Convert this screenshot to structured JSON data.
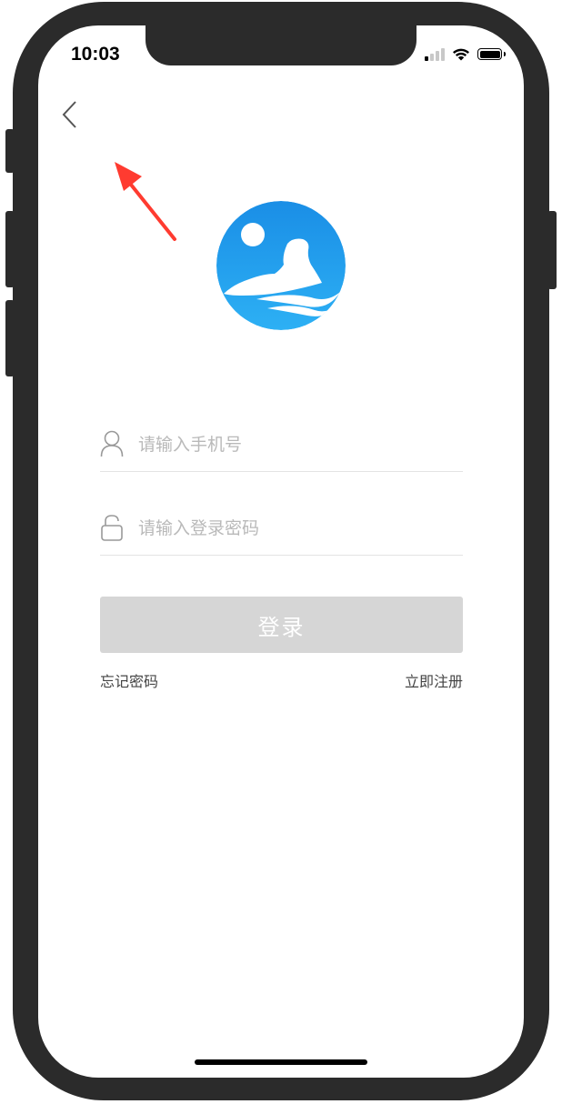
{
  "status_bar": {
    "time": "10:03"
  },
  "nav": {
    "back_icon": "chevron-left-icon"
  },
  "logo": {
    "icon": "app-logo",
    "color": "#2196f3"
  },
  "form": {
    "phone_placeholder": "请输入手机号",
    "password_placeholder": "请输入登录密码",
    "login_label": "登录",
    "login_button_color": "#d6d6d6"
  },
  "links": {
    "forgot_password": "忘记密码",
    "register": "立即注册"
  },
  "annotation": {
    "color": "#ff3b30"
  }
}
